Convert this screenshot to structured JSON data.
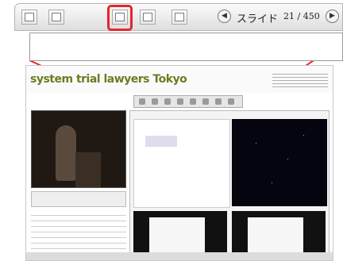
{
  "toolbar": {
    "buttons": [
      {
        "name": "notes-view-icon"
      },
      {
        "name": "slide-view-icon"
      },
      {
        "name": "tiles-view-icon",
        "highlighted": true
      },
      {
        "name": "outline-view-icon"
      },
      {
        "name": "list-view-icon"
      }
    ],
    "nav": {
      "prev_icon": "◀",
      "label": "スライド",
      "counter": "21 / 450",
      "next_icon": "▶"
    },
    "highlight_color": "#e8232a"
  },
  "screenshot": {
    "title_prefix": "system ",
    "title_main": "trial lawyers",
    "title_suffix": "Tokyo"
  },
  "colors": {
    "accent": "#e8232a",
    "toolbar_border": "#b5b5b5",
    "title_green": "#8a9a2d"
  }
}
